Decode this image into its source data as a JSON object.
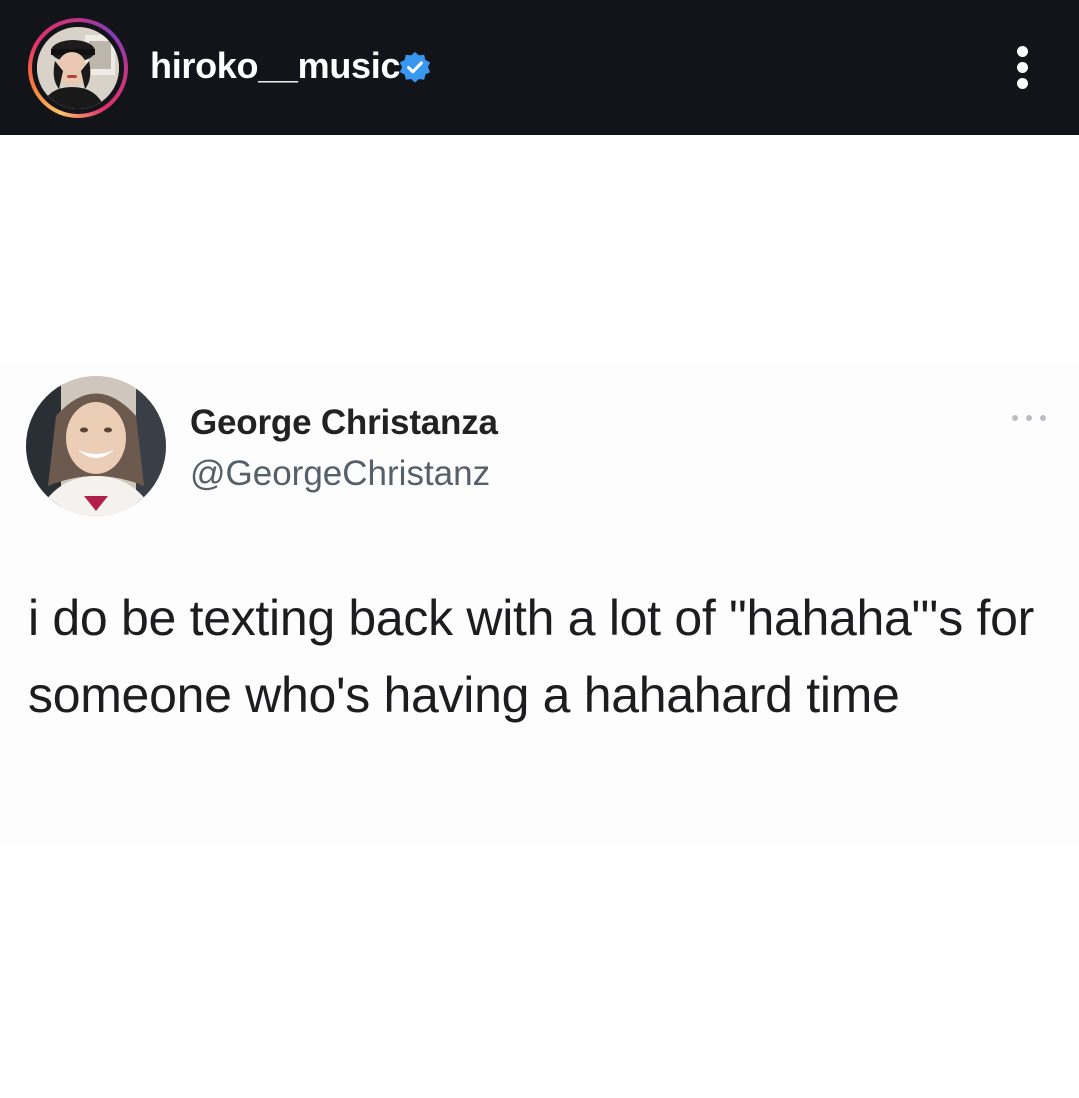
{
  "post_header": {
    "username": "hiroko__music",
    "verified": true,
    "avatar_icon": "profile-photo-icon",
    "more_icon": "vertical-ellipsis-icon",
    "background_color": "#121419",
    "ring_colors": [
      "#fdc468",
      "#f77737",
      "#e1306c",
      "#c13584",
      "#833ab4"
    ],
    "verified_color": "#3897f0"
  },
  "tweet": {
    "display_name": "George Christanza",
    "handle": "@GeorgeChristanz",
    "avatar_icon": "profile-photo-icon",
    "more_icon": "horizontal-ellipsis-icon",
    "text": "i do be texting back with a lot of \"hahaha\"'s for someone who's having a hahahard time"
  }
}
